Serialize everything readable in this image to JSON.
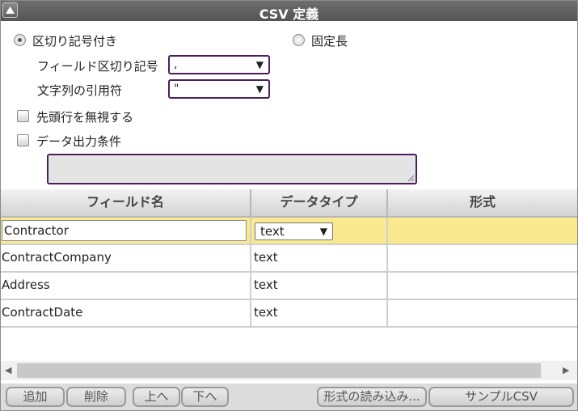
{
  "window": {
    "title": "CSV 定義"
  },
  "options": {
    "delimited_label": "区切り記号付き",
    "fixed_label": "固定長",
    "field_separator_label": "フィールド区切り記号",
    "field_separator_value": ",",
    "quote_label": "文字列の引用符",
    "quote_value": "\"",
    "skip_header_label": "先頭行を無視する",
    "output_condition_label": "データ出力条件",
    "output_condition_value": ""
  },
  "table": {
    "headers": [
      "フィールド名",
      "データタイプ",
      "形式"
    ],
    "rows": [
      {
        "name": "Contractor",
        "type": "text",
        "format": ""
      },
      {
        "name": "ContractCompany",
        "type": "text",
        "format": ""
      },
      {
        "name": "Address",
        "type": "text",
        "format": ""
      },
      {
        "name": "ContractDate",
        "type": "text",
        "format": ""
      }
    ]
  },
  "buttons": {
    "add": "追加",
    "delete": "削除",
    "up": "上へ",
    "down": "下へ",
    "load_format": "形式の読み込み...",
    "sample_csv": "サンプルCSV"
  },
  "icons": {
    "collapse": "collapse-triangle-icon",
    "dropdown": "dropdown-arrow-icon",
    "scroll_left": "scroll-left-icon",
    "scroll_right": "scroll-right-icon",
    "resize": "resize-grip-icon"
  },
  "colors": {
    "titlebar": "#5e5e5e",
    "selected_row": "#fbe98f",
    "field_border": "#4b1f5c"
  }
}
